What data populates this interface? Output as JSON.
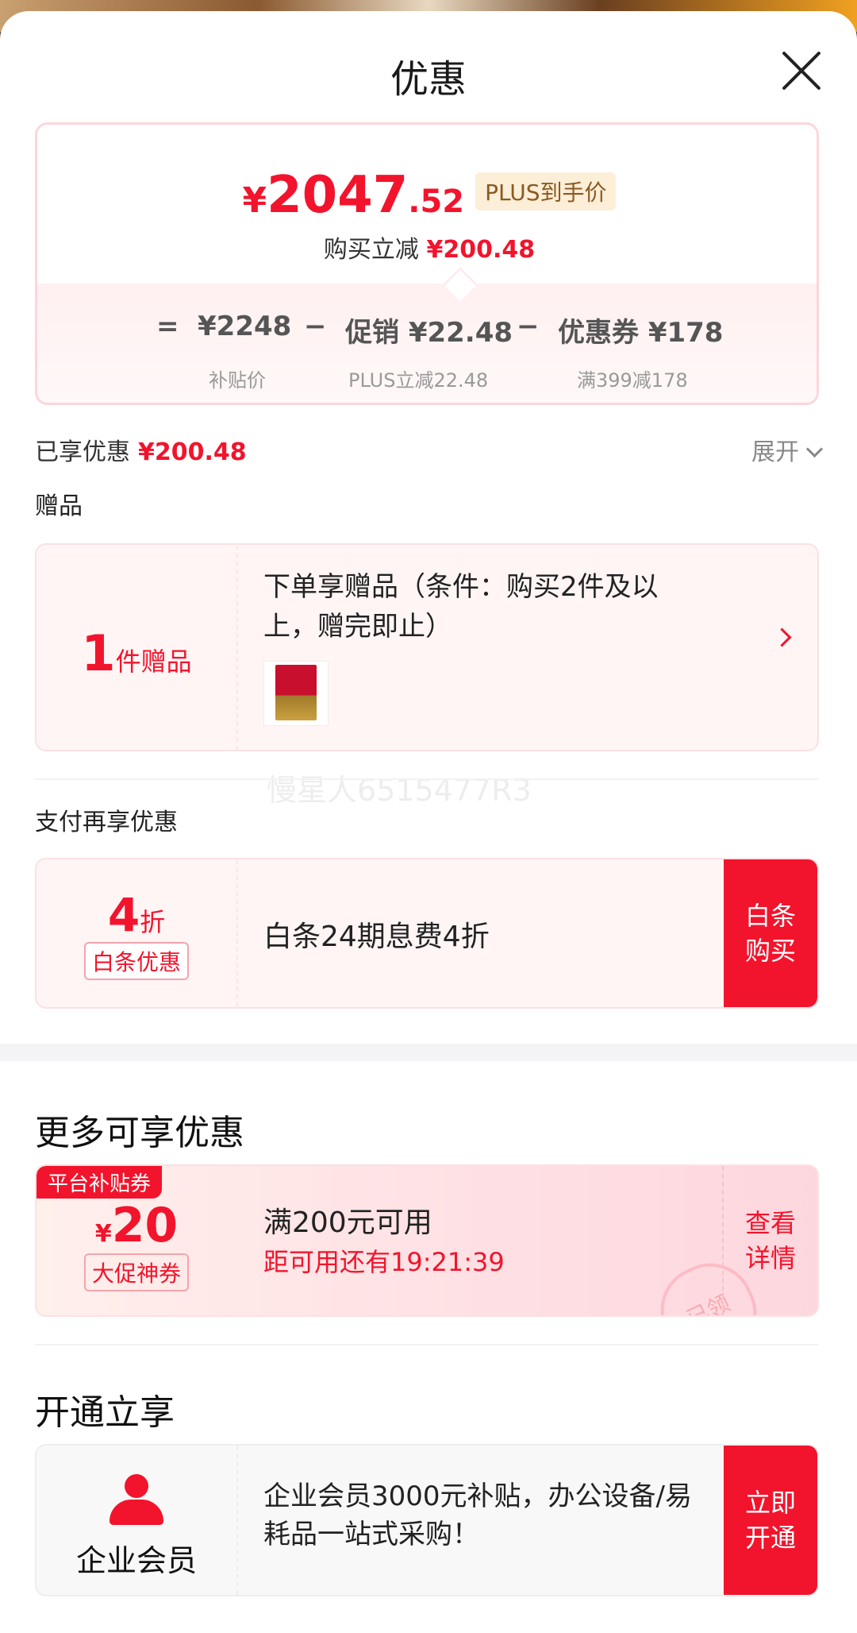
{
  "sheet": {
    "title": "优惠"
  },
  "price": {
    "currency": "¥",
    "integer": "2047",
    "decimal": ".52",
    "plus_tag": "PLUS到手价",
    "reduce_label": "购买立减",
    "reduce_amount": "¥200.48"
  },
  "formula": {
    "eq": "=",
    "base": "¥2248",
    "base_label": "补贴价",
    "minus1": "−",
    "promo": "促销 ¥22.48",
    "promo_label": "PLUS立减22.48",
    "minus2": "−",
    "coupon": "优惠券 ¥178",
    "coupon_label": "满399减178"
  },
  "enjoyed": {
    "label": "已享优惠",
    "amount": "¥200.48",
    "expand": "展开"
  },
  "gift": {
    "section": "赠品",
    "count": "1",
    "count_unit": "件赠品",
    "desc": "下单享赠品（条件：购买2件及以上，赠完即止）"
  },
  "watermark": "慢星人6515477R3",
  "payment": {
    "section": "支付再享优惠",
    "discount": "4",
    "discount_unit": "折",
    "tag": "白条优惠",
    "desc": "白条24期息费4折",
    "cta": "白条购买"
  },
  "more": {
    "section": "更多可享优惠",
    "badge": "平台补贴券",
    "currency": "¥",
    "amount": "20",
    "tag": "大促神券",
    "condition": "满200元可用",
    "countdown": "距可用还有19:21:39",
    "stamp": "已领",
    "cta": "查看详情"
  },
  "membership": {
    "section": "开通立享",
    "name": "企业会员",
    "desc": " 企业会员3000元补贴，办公设备/易耗品一站式采购！",
    "cta": "立即开通"
  },
  "colors": {
    "accent": "#f2142c",
    "plus_tag_bg": "#fdeed8"
  }
}
